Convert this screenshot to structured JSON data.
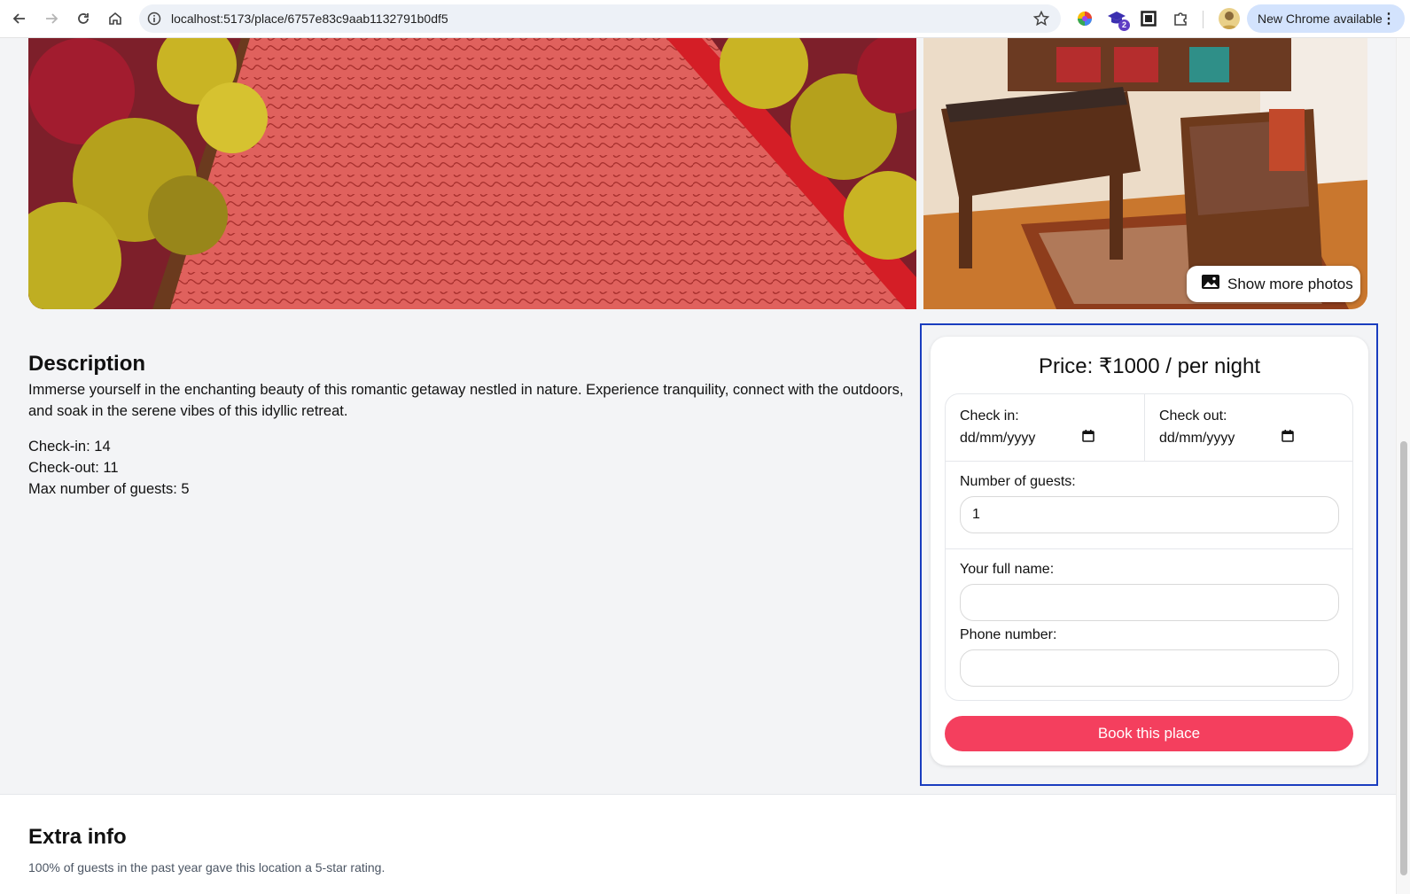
{
  "browser": {
    "url": "localhost:5173/place/6757e83c9aab1132791b0df5",
    "update_label": "New Chrome available",
    "extension_badge": "2",
    "icons": [
      "back-icon",
      "forward-icon",
      "reload-icon",
      "home-icon",
      "site-info-icon",
      "bookmark-star-icon",
      "color-wheel-extension-icon",
      "graduation-cap-extension-icon",
      "screenshot-extension-icon",
      "extensions-puzzle-icon",
      "profile-avatar",
      "menu-dots-icon"
    ]
  },
  "gallery": {
    "show_more_label": "Show more photos"
  },
  "description": {
    "title": "Description",
    "text": "Immerse yourself in the enchanting beauty of this romantic getaway nestled in nature. Experience tranquility, connect with the outdoors, and soak in the serene vibes of this idyllic retreat.",
    "check_in": "Check-in: 14",
    "check_out": "Check-out: 11",
    "max_guests": "Max number of guests: 5"
  },
  "booking": {
    "price": "Price: ₹1000 / per night",
    "check_in_label": "Check in:",
    "check_in_placeholder": "dd/mm/yyyy",
    "check_out_label": "Check out:",
    "check_out_placeholder": "dd/mm/yyyy",
    "guests_label": "Number of guests:",
    "guests_value": "1",
    "name_label": "Your full name:",
    "name_value": "",
    "phone_label": "Phone number:",
    "phone_value": "",
    "button_label": "Book this place"
  },
  "extra": {
    "title": "Extra info",
    "text": "100% of guests in the past year gave this location a 5-star rating."
  },
  "colors": {
    "primary": "#f43f5e",
    "focus_outline": "#1a3dbf",
    "page_bg": "#f3f4f6"
  }
}
